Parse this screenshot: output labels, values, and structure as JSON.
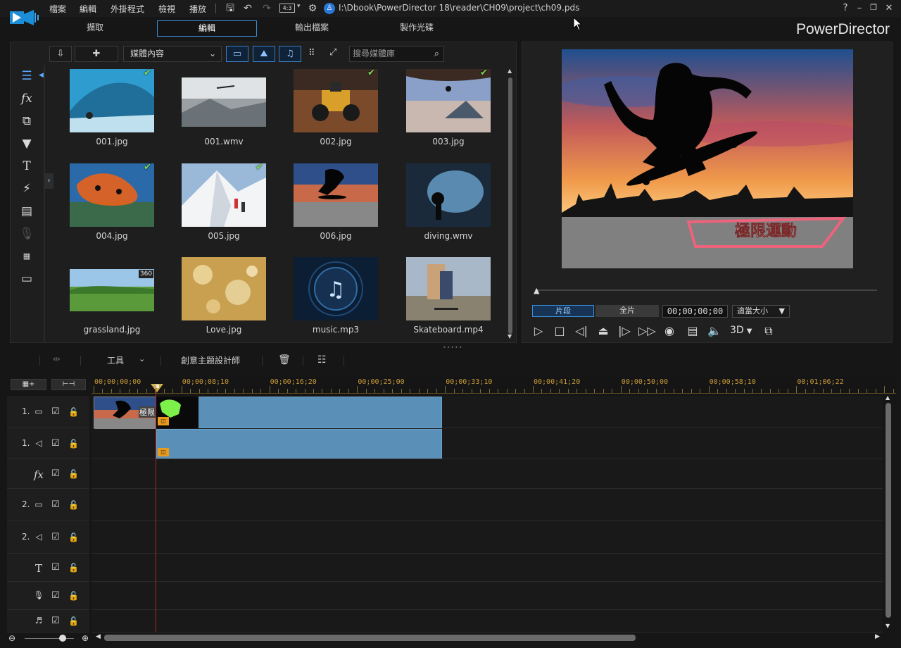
{
  "app": {
    "brand": "PowerDirector",
    "file_path": "I:\\Dbook\\PowerDirector 18\\reader\\CH09\\project\\ch09.pds",
    "aspect_ratio": "4:3"
  },
  "menu": [
    "檔案",
    "編輯",
    "外掛程式",
    "檢視",
    "播放"
  ],
  "modes": [
    {
      "label": "擷取",
      "active": false
    },
    {
      "label": "編輯",
      "active": true
    },
    {
      "label": "輸出檔案",
      "active": false
    },
    {
      "label": "製作光碟",
      "active": false
    }
  ],
  "library": {
    "dropdown_value": "媒體內容",
    "search_placeholder": "搜尋媒體庫",
    "items": [
      {
        "name": "001.jpg",
        "checked": true,
        "kind": "surf"
      },
      {
        "name": "001.wmv",
        "checked": false,
        "kind": "glider"
      },
      {
        "name": "002.jpg",
        "checked": true,
        "kind": "atv"
      },
      {
        "name": "003.jpg",
        "checked": true,
        "kind": "cliff"
      },
      {
        "name": "004.jpg",
        "checked": true,
        "kind": "skydive"
      },
      {
        "name": "005.jpg",
        "checked": true,
        "kind": "snow"
      },
      {
        "name": "006.jpg",
        "checked": false,
        "kind": "skater"
      },
      {
        "name": "diving.wmv",
        "checked": false,
        "kind": "cave"
      },
      {
        "name": "grassland.jpg",
        "checked": false,
        "kind": "grass",
        "badge": "360"
      },
      {
        "name": "Love.jpg",
        "checked": false,
        "kind": "love"
      },
      {
        "name": "music.mp3",
        "checked": false,
        "kind": "music"
      },
      {
        "name": "Skateboard.mp4",
        "checked": false,
        "kind": "skate2"
      }
    ]
  },
  "preview": {
    "title_text": "極限運動",
    "tab_clip": "片段",
    "tab_movie": "全片",
    "timecode": "00;00;00;00",
    "zoom": "適當大小",
    "mode_3d": "3D"
  },
  "timeline_toolbar": {
    "tools": "工具",
    "theme_designer": "創意主題設計師"
  },
  "ruler": [
    "00;00;00;00",
    "00;00;08;10",
    "00;00;16;20",
    "00;00;25;00",
    "00;00;33;10",
    "00;00;41;20",
    "00;00;50;00",
    "00;00;58;10",
    "00;01;06;22"
  ],
  "tracks": [
    {
      "label": "1.",
      "icon": "video-track-icon",
      "glyph": "▭"
    },
    {
      "label": "1.",
      "icon": "audio-track-icon",
      "glyph": "◁"
    },
    {
      "label": "",
      "icon": "fx-track-icon",
      "glyph": "fx"
    },
    {
      "label": "2.",
      "icon": "video-track-icon",
      "glyph": "▭"
    },
    {
      "label": "2.",
      "icon": "audio-track-icon",
      "glyph": "◁"
    },
    {
      "label": "",
      "icon": "title-track-icon",
      "glyph": "T"
    },
    {
      "label": "",
      "icon": "voice-track-icon",
      "glyph": "🎙"
    },
    {
      "label": "",
      "icon": "music-track-icon",
      "glyph": "♬"
    }
  ],
  "clip_title_text": "極限",
  "colors": {
    "accent": "#3a8ddb",
    "clip": "#5a90b8",
    "playhead": "#b3252b",
    "ruler_text": "#c89a3a",
    "check": "#7ed957"
  }
}
